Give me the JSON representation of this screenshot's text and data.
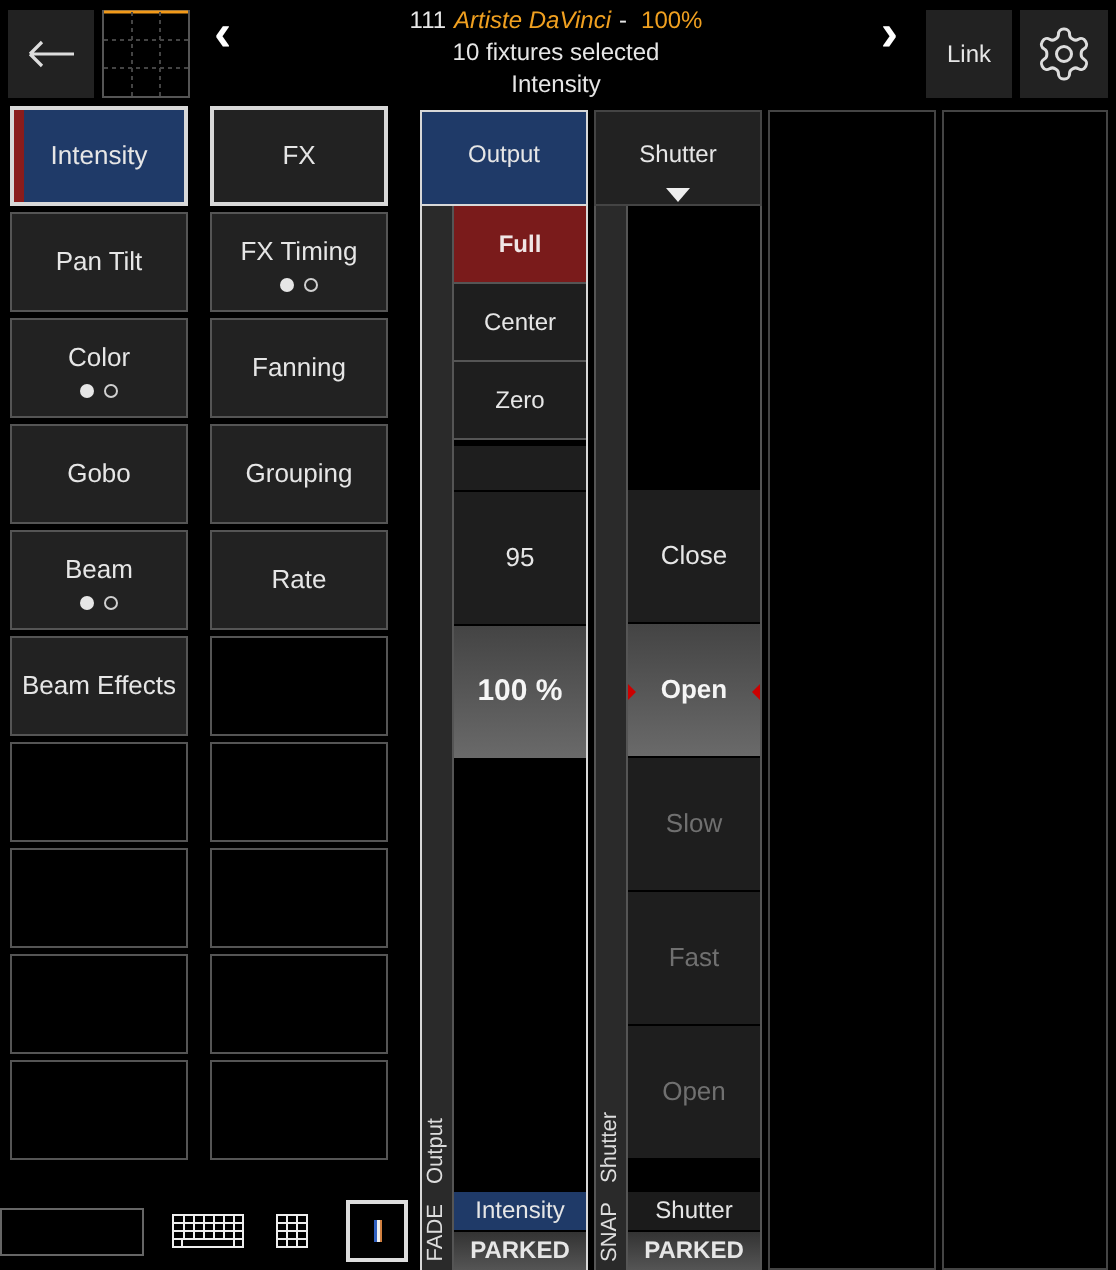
{
  "header": {
    "fixture_number": "111",
    "fixture_name": "Artiste DaVinci",
    "separator": "-",
    "intensity": "100%",
    "selection": "10 fixtures selected",
    "attribute": "Intensity",
    "prev": "‹",
    "next": "›",
    "link_button": "Link"
  },
  "attribute_buttons": [
    {
      "label": "Intensity",
      "selected": true
    },
    {
      "label": "FX",
      "selected": false
    },
    {
      "label": "Pan Tilt",
      "selected": false
    },
    {
      "label": "FX Timing",
      "selected": false,
      "pages": [
        {
          "selected": true
        },
        {
          "selected": false
        }
      ]
    },
    {
      "label": "Color",
      "selected": false,
      "pages": [
        {
          "selected": true
        },
        {
          "selected": false
        }
      ]
    },
    {
      "label": "Fanning",
      "selected": false
    },
    {
      "label": "Gobo",
      "selected": false
    },
    {
      "label": "Grouping",
      "selected": false
    },
    {
      "label": "Beam",
      "selected": false,
      "pages": [
        {
          "selected": true
        },
        {
          "selected": false
        }
      ]
    },
    {
      "label": "Rate",
      "selected": false
    },
    {
      "label": "Beam Effects",
      "selected": false
    }
  ],
  "columns": [
    {
      "header": "Output",
      "selected": true,
      "has_menu": false,
      "strip_label": "Output",
      "mode": "FADE",
      "footer": "Intensity",
      "footer_selected": true,
      "status": "PARKED",
      "items": [
        {
          "kind": "preset",
          "label": "Full",
          "active": true
        },
        {
          "kind": "preset",
          "label": "Center",
          "active": false
        },
        {
          "kind": "preset",
          "label": "Zero",
          "active": false
        },
        {
          "kind": "spacer"
        },
        {
          "kind": "value",
          "label": "95",
          "selected": false
        },
        {
          "kind": "value",
          "label": "100 %",
          "selected": true
        }
      ]
    },
    {
      "header": "Shutter",
      "selected": false,
      "has_menu": true,
      "strip_label": "Shutter",
      "mode": "SNAP",
      "footer": "Shutter",
      "footer_selected": false,
      "status": "PARKED",
      "items": [
        {
          "kind": "value",
          "label": "Close",
          "selected": false,
          "disabled": false
        },
        {
          "kind": "value",
          "label": "Open",
          "selected": true,
          "disabled": false
        },
        {
          "kind": "value",
          "label": "Slow",
          "selected": false,
          "disabled": true
        },
        {
          "kind": "value",
          "label": "Fast",
          "selected": false,
          "disabled": true
        },
        {
          "kind": "value",
          "label": "Open",
          "selected": false,
          "disabled": true
        }
      ]
    }
  ]
}
